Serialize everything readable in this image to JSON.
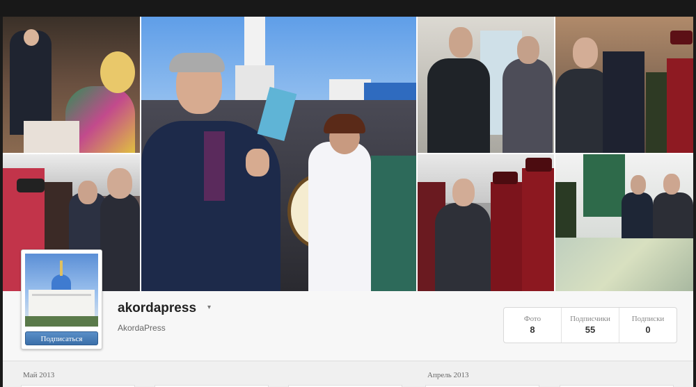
{
  "profile": {
    "username": "akordapress",
    "caret": "▾",
    "full_name": "AkordaPress",
    "follow_label": "Подписаться"
  },
  "stats": [
    {
      "label": "Фото",
      "value": "8"
    },
    {
      "label": "Подписчики",
      "value": "55"
    },
    {
      "label": "Подписки",
      "value": "0"
    }
  ],
  "months": {
    "first": "Май 2013",
    "second": "Апрель 2013"
  },
  "photos": [
    {
      "name": "photo-ceremony-crowd"
    },
    {
      "name": "photo-drum-celebration"
    },
    {
      "name": "photo-officials-meeting"
    },
    {
      "name": "photo-guard-greeting"
    },
    {
      "name": "photo-folk-costumes"
    },
    {
      "name": "photo-honor-guard"
    },
    {
      "name": "photo-model-viewing"
    }
  ],
  "colors": {
    "follow_button": "#3b6fa9",
    "background": "#f0f0f0"
  }
}
